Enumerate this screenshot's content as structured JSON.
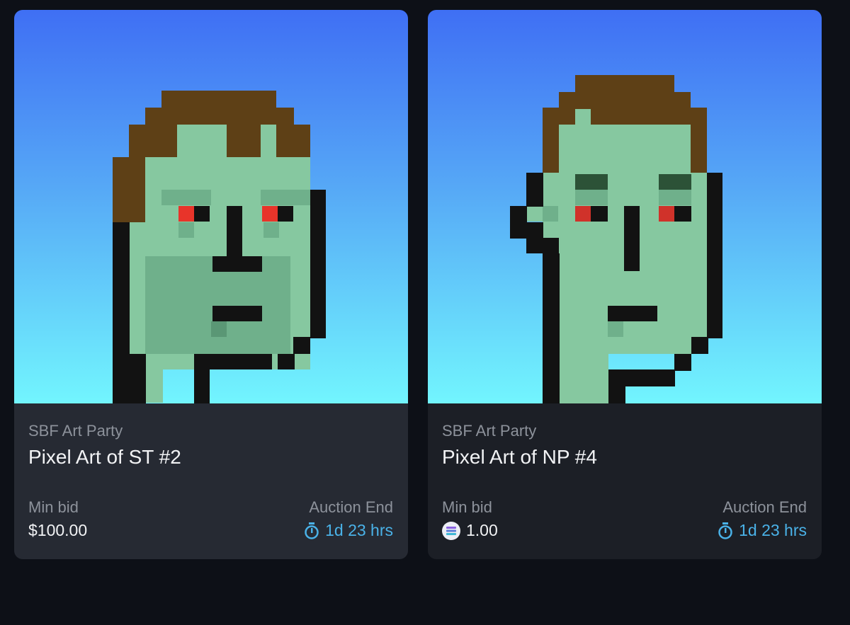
{
  "cards": [
    {
      "collection": "SBF Art Party",
      "title": "Pixel Art of ST #2",
      "min_bid_label": "Min bid",
      "min_bid_value": "$100.00",
      "auction_end_label": "Auction End",
      "auction_end_value": "1d 23 hrs"
    },
    {
      "collection": "SBF Art Party",
      "title": "Pixel Art of NP #4",
      "min_bid_label": "Min bid",
      "min_bid_value": "1.00",
      "min_bid_icon": "solana-coin-icon",
      "auction_end_label": "Auction End",
      "auction_end_value": "1d 23 hrs"
    }
  ],
  "icons": {
    "timer": "stopwatch-icon"
  },
  "colors": {
    "background": "#0d1017",
    "countdown": "#4ab2e8",
    "hair": "#5e4016",
    "skin": "#86c8a0",
    "eyes": "#e8342a"
  }
}
